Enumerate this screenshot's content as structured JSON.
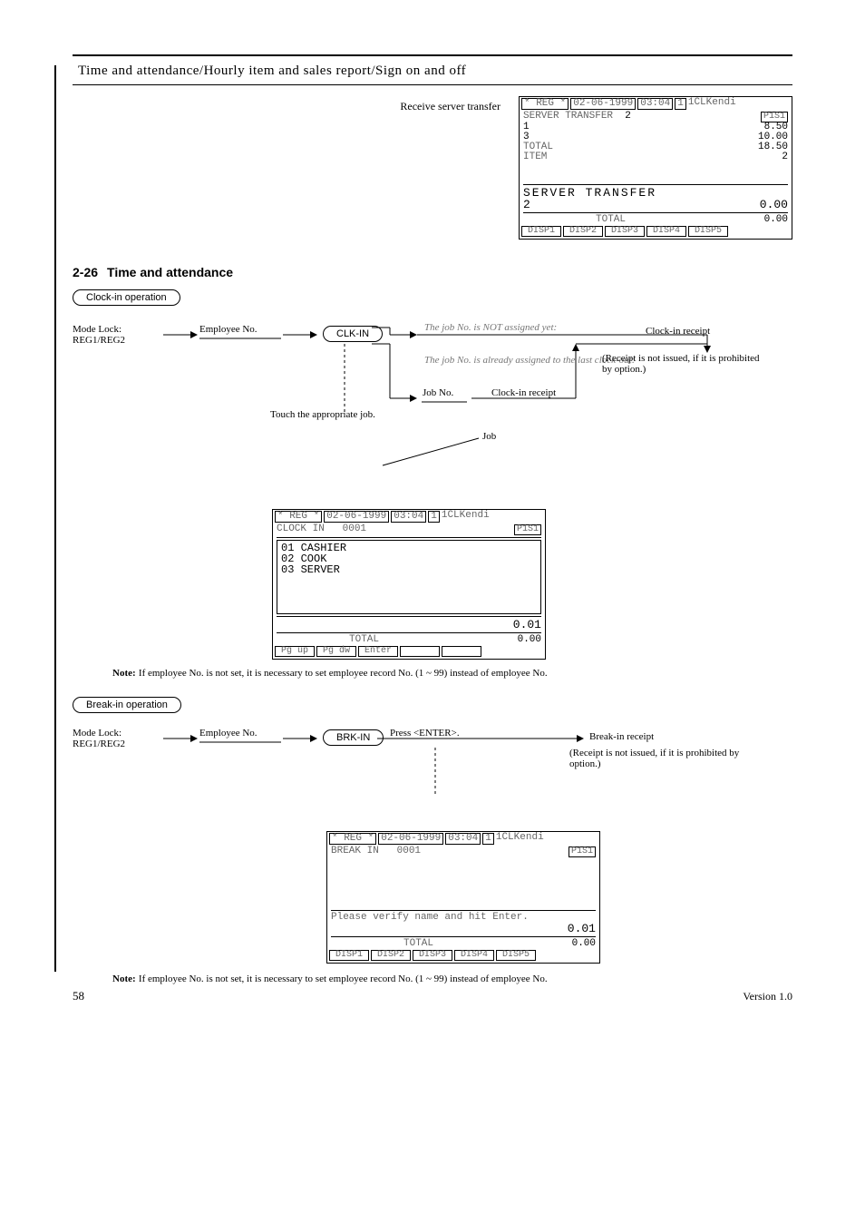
{
  "header_bar": {
    "title": "Time and attendance/Hourly item and sales report/Sign on and off"
  },
  "para_receive": "Receive server transfer",
  "pos1": {
    "mode": "* REG *",
    "date": "02-06-1999",
    "time": "03:04",
    "term": "1",
    "clk": "1CLKendi",
    "title_left": "SERVER TRANSFER",
    "title_right": "2",
    "badge": "P1S1",
    "lines": [
      {
        "l": "    1",
        "r": "8.50"
      },
      {
        "l": "    3",
        "r": "10.00"
      },
      {
        "l": "TOTAL",
        "r": "18.50"
      },
      {
        "l": "ITEM",
        "r": "2"
      }
    ],
    "mid_title": "SERVER  TRANSFER",
    "mid_left": "   2",
    "mid_right": "0.00",
    "total_label": "TOTAL",
    "total_value": "0.00",
    "btns": [
      "DISP1",
      "DISP2",
      "DISP3",
      "DISP4",
      "DISP5"
    ]
  },
  "section2_num": "2-26",
  "section2_title": "Time and attendance",
  "clockin_heading": "Clock-in operation",
  "flow1": {
    "mode_lock": "Mode Lock:",
    "modes": "REG1/REG2",
    "employee_no_label": "Employee No.",
    "key_clockin": "CLK-IN",
    "receipt1": "Clock-in receipt",
    "job_no_label": "Job No.",
    "receipt2": "Clock-in receipt",
    "receipt_note": "(Receipt is not issued, if it is prohibited by option.)",
    "touch_note": "Touch the appropriate job.",
    "note_heading": "Note:",
    "note_body": "If employee No. is not set, it is necessary to set employee record No. (1 ~ 99) instead of employee No.",
    "not_yet_title": "The job No. is NOT assigned yet:",
    "already_title": "The job No. is already assigned to the last clock-out:",
    "job_label": "Job"
  },
  "pos2": {
    "mode": "* REG *",
    "date": "02-06-1999",
    "time": "03:04",
    "term": "1",
    "clk": "1CLKendi",
    "title_left": "CLOCK IN",
    "title_right": "0001",
    "badge": "P1S1",
    "opts": [
      {
        "n": "01",
        "t": "CASHIER"
      },
      {
        "n": "02",
        "t": "COOK"
      },
      {
        "n": "03",
        "t": "SERVER"
      }
    ],
    "amount": "0.01",
    "total_label": "TOTAL",
    "total_value": "0.00",
    "btns": [
      "Pg up",
      "Pg dw",
      "Enter",
      "",
      ""
    ]
  },
  "breakin_heading": "Break-in operation",
  "flow2": {
    "mode_lock": "Mode Lock:",
    "modes": "REG1/REG2",
    "employee_no_label": "Employee No.",
    "key_breakin": "BRK-IN",
    "press_enter": "Press <ENTER>.",
    "receipt": "Break-in receipt",
    "receipt_note": "(Receipt is not issued, if it is prohibited by option.)",
    "note_heading": "Note:",
    "note_body": "If employee No. is not set, it is necessary to set employee record No. (1 ~ 99) instead of employee No."
  },
  "pos3": {
    "mode": "* REG *",
    "date": "02-06-1999",
    "time": "03:04",
    "term": "1",
    "clk": "1CLKendi",
    "title_left": "BREAK IN",
    "title_right": "0001",
    "badge": "P1S1",
    "msg": "Please verify name and hit Enter.",
    "amount": "0.01",
    "total_label": "TOTAL",
    "total_value": "0.00",
    "btns": [
      "DISP1",
      "DISP2",
      "DISP3",
      "DISP4",
      "DISP5"
    ]
  },
  "footer": {
    "page": "58",
    "text": "Version 1.0"
  }
}
